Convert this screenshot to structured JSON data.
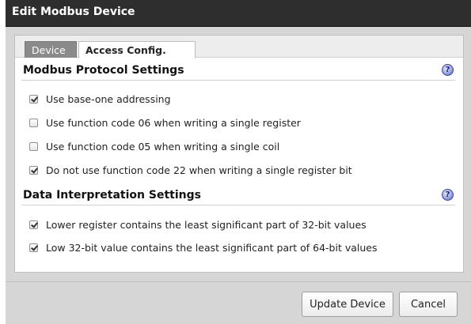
{
  "dialog": {
    "title": "Edit Modbus Device"
  },
  "tabs": [
    {
      "label": "Device",
      "active": false
    },
    {
      "label": "Access Config.",
      "active": true
    }
  ],
  "sections": [
    {
      "title": "Modbus Protocol Settings",
      "help_icon": "question-mark-icon",
      "options": [
        {
          "label": "Use base-one addressing",
          "checked": true
        },
        {
          "label": "Use function code 06 when writing a single register",
          "checked": false
        },
        {
          "label": "Use function code 05 when writing a single coil",
          "checked": false
        },
        {
          "label": "Do not use function code 22 when writing a single register bit",
          "checked": true
        }
      ]
    },
    {
      "title": "Data Interpretation Settings",
      "help_icon": "question-mark-icon",
      "options": [
        {
          "label": "Lower register contains the least significant part of 32-bit values",
          "checked": true
        },
        {
          "label": "Low 32-bit value contains the least significant part of 64-bit values",
          "checked": true
        }
      ]
    }
  ],
  "buttons": {
    "update_label": "Update Device",
    "cancel_label": "Cancel"
  },
  "colors": {
    "titlebar": "#2e2e2e",
    "dialog_bg": "#d6d6d6",
    "inactive_tab": "#8a8a8a"
  }
}
